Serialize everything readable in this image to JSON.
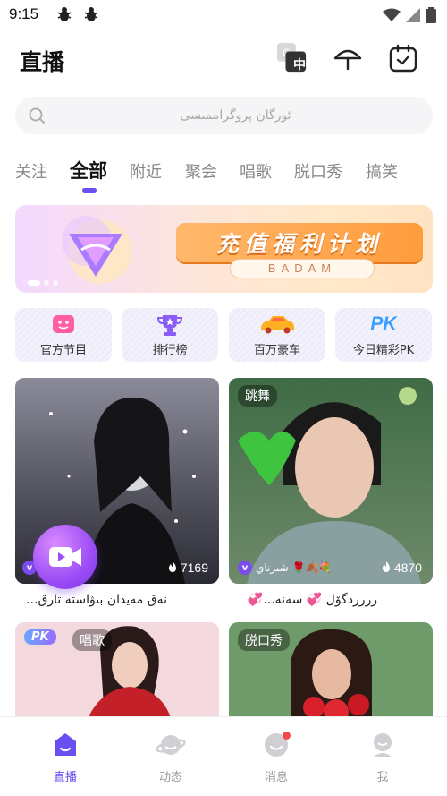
{
  "status_bar": {
    "time": "9:15",
    "notif_icon": "bug-icon"
  },
  "header": {
    "title": "直播",
    "translate_badge": "中"
  },
  "search": {
    "placeholder": "ئورگان پروگراممىسى"
  },
  "tabs": [
    {
      "label": "关注"
    },
    {
      "label": "全部",
      "active": true
    },
    {
      "label": "附近"
    },
    {
      "label": "聚会"
    },
    {
      "label": "唱歌"
    },
    {
      "label": "脱口秀"
    },
    {
      "label": "搞笑"
    }
  ],
  "banner": {
    "title": "充值福利计划",
    "subtitle": "BADAM"
  },
  "quick_entries": [
    {
      "label": "官方节目",
      "icon": "tv-icon"
    },
    {
      "label": "排行榜",
      "icon": "trophy-icon"
    },
    {
      "label": "百万豪车",
      "icon": "car-icon"
    },
    {
      "label": "今日精彩PK",
      "icon": "pk-icon"
    }
  ],
  "cards": [
    {
      "viewers": "7169",
      "caption": "نەق مەيدان بىۋاستە تارق...",
      "name_overlay": ""
    },
    {
      "tag": "跳舞",
      "viewers": "4870",
      "caption": "رررردگۆل 💞 سەنە...💞",
      "name_overlay": "شىرناي 🌹🍂💐"
    },
    {
      "pk": "PK",
      "tag": "唱歌"
    },
    {
      "tag": "脱口秀"
    }
  ],
  "bottom_nav": [
    {
      "label": "直播",
      "active": true,
      "icon": "live-home-icon"
    },
    {
      "label": "动态",
      "icon": "planet-icon"
    },
    {
      "label": "消息",
      "icon": "chat-icon",
      "badge": true
    },
    {
      "label": "我",
      "icon": "profile-icon"
    }
  ],
  "colors": {
    "accent": "#6a4ff0",
    "fab": "#9c4df5"
  }
}
